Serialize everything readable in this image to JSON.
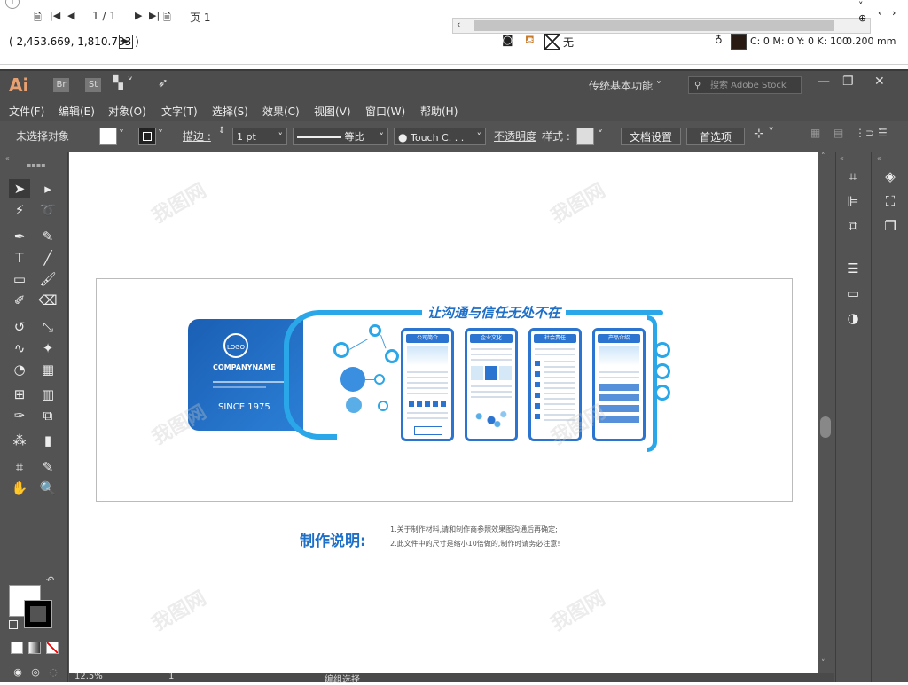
{
  "viewer": {
    "page_current": "1 / 1",
    "page_tab": "页 1",
    "coords": "( 2,453.669, 1,810.733 )",
    "no_fill_label": "无",
    "color_readout": "C: 0 M: 0 Y: 0 K: 100",
    "stroke_width": "0.200 mm"
  },
  "app": {
    "logo": "Ai",
    "bridge": "Br",
    "stock_app": "St",
    "workspace": "传统基本功能",
    "stock_search_placeholder": "搜索 Adobe Stock"
  },
  "menu": [
    "文件(F)",
    "编辑(E)",
    "对象(O)",
    "文字(T)",
    "选择(S)",
    "效果(C)",
    "视图(V)",
    "窗口(W)",
    "帮助(H)"
  ],
  "control": {
    "no_selection": "未选择对象",
    "stroke_label": "描边 :",
    "stroke_value": "1 pt",
    "profile": "等比",
    "brush": "Touch C. . .",
    "opacity": "不透明度",
    "style_label": "样式 :",
    "doc_setup": "文档设置",
    "preferences": "首选项"
  },
  "status": {
    "zoom": "12.5%",
    "page": "1",
    "mode": "编组选择"
  },
  "design": {
    "wall_title": "让沟通与信任无处不在",
    "logo_text": "LOGO",
    "company": "COMPANYNAME",
    "since": "SINCE 1975",
    "cards": [
      "公司简介",
      "企业文化",
      "社会责任",
      "产品介绍"
    ],
    "note_title": "制作说明:",
    "note_1": "1.关于制作材料,请和制作商参照效果图沟通后再确定;",
    "note_2": "2.此文件中的尺寸是缩小10倍做的,制作时请务必注意!"
  },
  "watermark": "我图网",
  "colors": {
    "brand_blue": "#1a5fb4",
    "accent_cyan": "#2aa7e8",
    "ui_dark": "#535353"
  }
}
